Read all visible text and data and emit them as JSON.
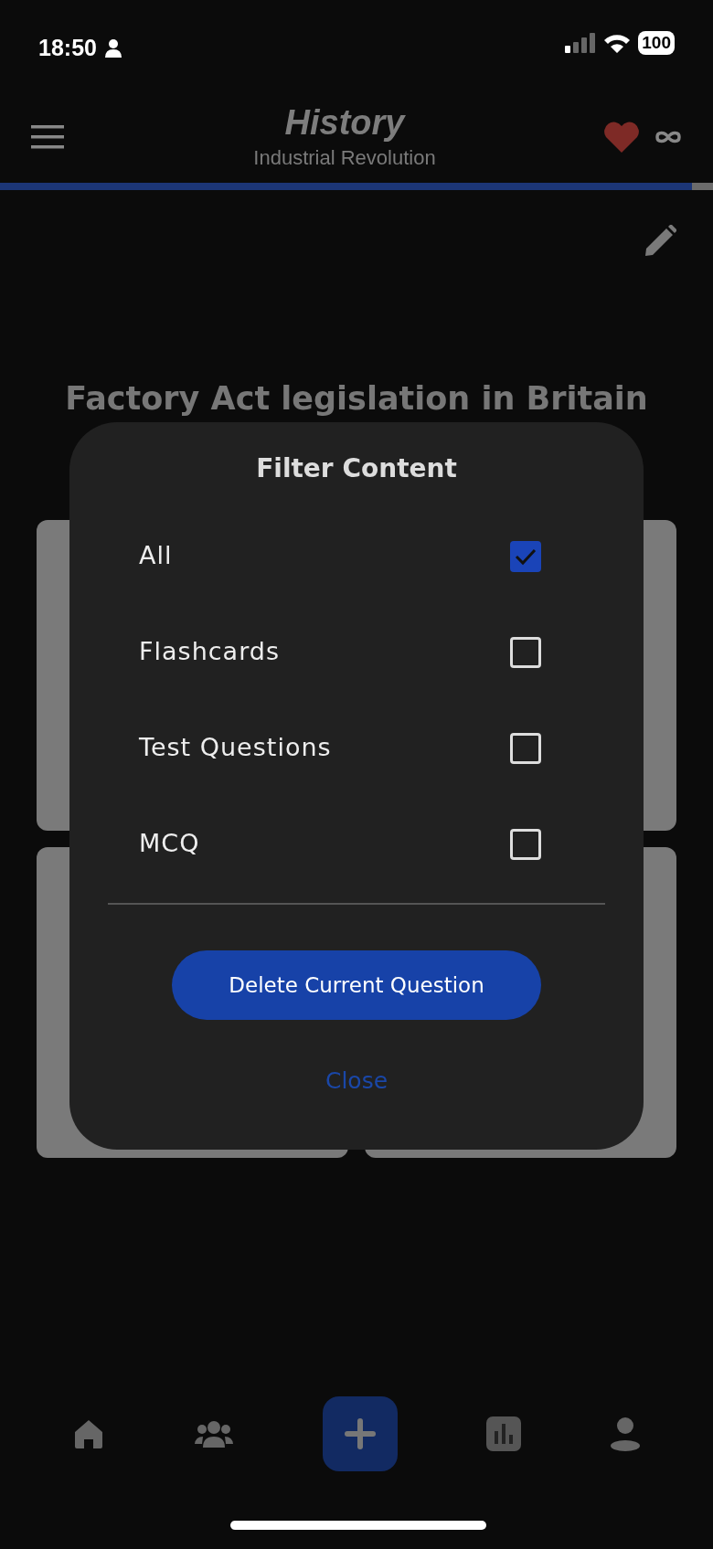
{
  "status_bar": {
    "time": "18:50",
    "battery": "100"
  },
  "header": {
    "title": "History",
    "subtitle": "Industrial Revolution",
    "progress": {
      "level": 0.97
    }
  },
  "question": {
    "title": "Factory Act legislation in Britain"
  },
  "dialog": {
    "title": "Filter Content",
    "options": [
      {
        "label": "All",
        "checked": true
      },
      {
        "label": "Flashcards",
        "checked": false
      },
      {
        "label": "Test Questions",
        "checked": false
      },
      {
        "label": "MCQ",
        "checked": false
      }
    ],
    "delete_button": "Delete Current Question",
    "close_link": "Close"
  }
}
